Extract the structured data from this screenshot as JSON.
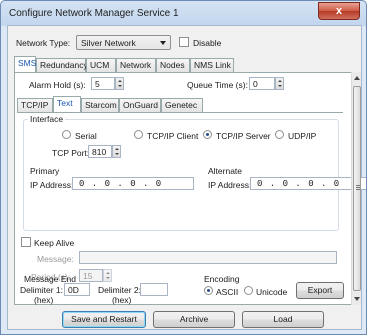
{
  "window": {
    "title": "Configure Network Manager Service 1",
    "close_glyph": "x"
  },
  "network": {
    "type_label": "Network Type:",
    "type_value": "Silver Network",
    "disable_label": "Disable"
  },
  "tabs": [
    "SMS",
    "Redundancy",
    "UCM",
    "Network",
    "Nodes",
    "NMS Link"
  ],
  "alarm_hold": {
    "label": "Alarm Hold (s):",
    "value": "5"
  },
  "queue_time": {
    "label": "Queue Time (s):",
    "value": "0"
  },
  "subtabs": [
    "TCP/IP",
    "Text",
    "Starcom",
    "OnGuard",
    "Genetec"
  ],
  "interface": {
    "title": "Interface",
    "options": [
      "Serial",
      "TCP/IP Client",
      "TCP/IP Server",
      "UDP/IP"
    ],
    "selected": "TCP/IP Server",
    "tcp_port_label": "TCP Port:",
    "tcp_port_value": "810",
    "primary": {
      "title": "Primary",
      "ip_label": "IP Address:",
      "ip": "0 . 0 . 0 . 0"
    },
    "alternate": {
      "title": "Alternate",
      "ip_label": "IP Address:",
      "ip": "0 . 0 . 0 . 0"
    }
  },
  "keep_alive": {
    "label": "Keep Alive",
    "message_label": "Message:",
    "message_value": "",
    "period_label": "Period (s):",
    "period_value": "15"
  },
  "message_end": {
    "title": "Message End",
    "delim1_label": "Delimiter 1:",
    "delim1_sub": "(hex)",
    "delim1_value": "0D",
    "delim2_label": "Delimiter 2:",
    "delim2_sub": "(hex)",
    "delim2_value": ""
  },
  "encoding": {
    "title": "Encoding",
    "options": [
      "ASCII",
      "Unicode"
    ],
    "selected": "ASCII",
    "export_label": "Export"
  },
  "footer": {
    "save_label": "Save and Restart",
    "archive_label": "Archive",
    "load_label": "Load"
  }
}
